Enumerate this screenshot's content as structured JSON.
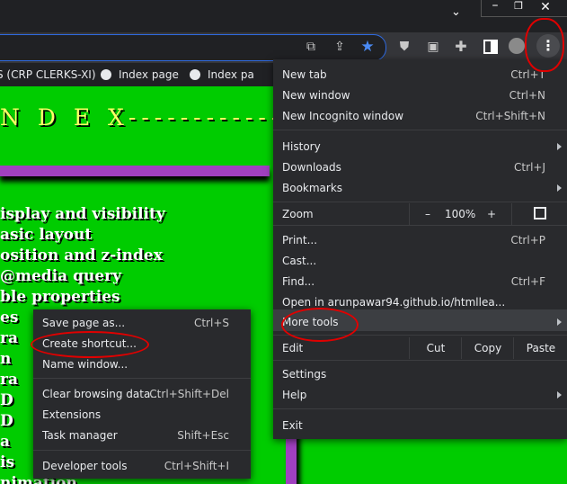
{
  "bookmarks_bar": {
    "items": [
      {
        "label": "S (CRP CLERKS-XI)"
      },
      {
        "label": "Index page"
      },
      {
        "label": "Index pa"
      }
    ]
  },
  "page": {
    "heading": "N D E X--------------",
    "topics": [
      "isplay and visibility",
      "asic layout",
      "osition and z-index",
      "@media query",
      "ble properties",
      "es",
      "ra",
      "n",
      "ra",
      "D",
      "D",
      "a",
      "is",
      "nimation"
    ]
  },
  "main_menu": {
    "items": [
      {
        "label": "New tab",
        "shortcut": "Ctrl+T"
      },
      {
        "label": "New window",
        "shortcut": "Ctrl+N"
      },
      {
        "label": "New Incognito window",
        "shortcut": "Ctrl+Shift+N"
      },
      {
        "label": "History",
        "shortcut": ""
      },
      {
        "label": "Downloads",
        "shortcut": "Ctrl+J"
      },
      {
        "label": "Bookmarks",
        "shortcut": ""
      },
      {
        "label": "Print...",
        "shortcut": "Ctrl+P"
      },
      {
        "label": "Cast...",
        "shortcut": ""
      },
      {
        "label": "Find...",
        "shortcut": "Ctrl+F"
      },
      {
        "label": "Open in arunpawar94.github.io/htmllea...",
        "shortcut": ""
      },
      {
        "label": "More tools",
        "shortcut": ""
      },
      {
        "label": "Settings",
        "shortcut": ""
      },
      {
        "label": "Help",
        "shortcut": ""
      },
      {
        "label": "Exit",
        "shortcut": ""
      }
    ],
    "zoom": {
      "label": "Zoom",
      "minus": "–",
      "value": "100%",
      "plus": "+"
    },
    "edit": {
      "label": "Edit",
      "cut": "Cut",
      "copy": "Copy",
      "paste": "Paste"
    }
  },
  "sub_menu": {
    "items": [
      {
        "label": "Save page as...",
        "shortcut": "Ctrl+S"
      },
      {
        "label": "Create shortcut...",
        "shortcut": ""
      },
      {
        "label": "Name window...",
        "shortcut": ""
      },
      {
        "label": "Clear browsing data...",
        "shortcut": "Ctrl+Shift+Del"
      },
      {
        "label": "Extensions",
        "shortcut": ""
      },
      {
        "label": "Task manager",
        "shortcut": "Shift+Esc"
      },
      {
        "label": "Developer tools",
        "shortcut": "Ctrl+Shift+I"
      }
    ]
  },
  "colors": {
    "page_background": "#00cc00",
    "heading": "#ffff66",
    "accent_bar": "#a040c0",
    "menu_background": "#292a2d",
    "annotation": "#e00000"
  }
}
